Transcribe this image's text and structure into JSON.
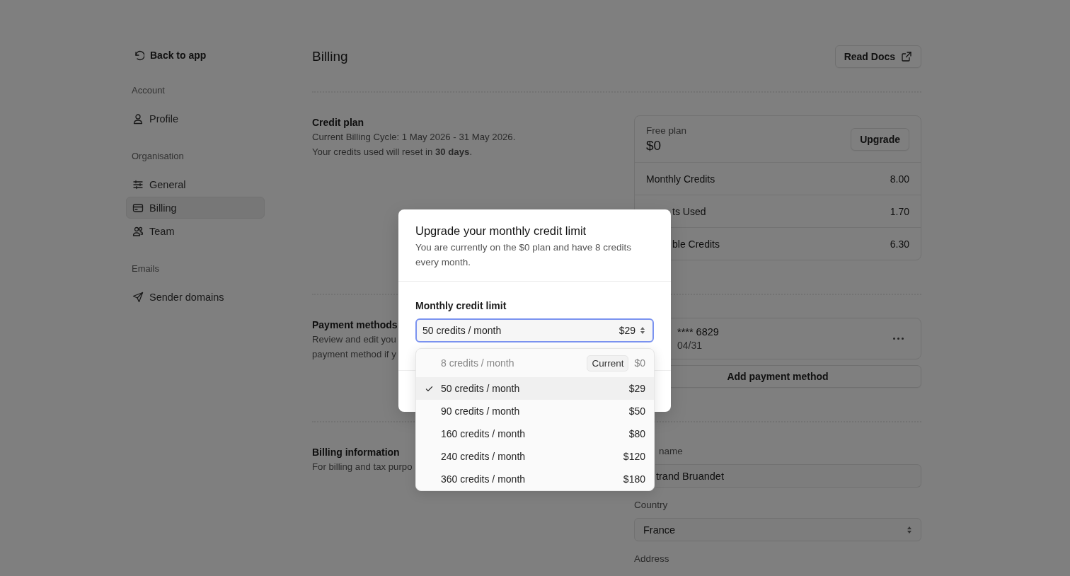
{
  "sidebar": {
    "back_link": "Back to app",
    "groups": [
      {
        "heading": "Account",
        "items": [
          {
            "label": "Profile",
            "kind": "user",
            "selected": false
          }
        ]
      },
      {
        "heading": "Organisation",
        "items": [
          {
            "label": "General",
            "kind": "sliders",
            "selected": false
          },
          {
            "label": "Billing",
            "kind": "card",
            "selected": true
          },
          {
            "label": "Team",
            "kind": "users",
            "selected": false
          }
        ]
      },
      {
        "heading": "Emails",
        "items": [
          {
            "label": "Sender domains",
            "kind": "send",
            "selected": false
          }
        ]
      }
    ]
  },
  "page": {
    "title": "Billing",
    "read_docs": "Read Docs"
  },
  "credit_plan": {
    "title": "Credit plan",
    "lines": [
      "Current Billing Cycle: 1 May 2026 - 31 May 2026.",
      "Your credits used will reset in **30 days**."
    ]
  },
  "plan_card": {
    "name": "Free plan",
    "price": "$0",
    "upgrade": "Upgrade",
    "rows": [
      {
        "label": "Monthly Credits",
        "value": "8.00"
      },
      {
        "label": "ts Used",
        "value": "1.70"
      },
      {
        "label": "ble Credits",
        "value": "6.30"
      }
    ]
  },
  "payment_methods": {
    "title": "Payment methods",
    "lines": [
      "Review and edit you",
      "payment method if y"
    ],
    "card": {
      "number": "**** 6829",
      "expiry": "04/31"
    },
    "add_button": "Add payment method"
  },
  "billing_information": {
    "title": "Billing information",
    "description": "For billing and tax purpo",
    "fields": [
      {
        "label": "name",
        "value": "trand Bruandet",
        "kind": "text"
      },
      {
        "label": "Country",
        "value": "France",
        "kind": "select"
      },
      {
        "label": "Address",
        "kind": "label"
      }
    ]
  },
  "modal": {
    "title": "Upgrade your monthly credit limit",
    "description": "You are currently on the $0 plan and have 8 credits every month.",
    "field_label": "Monthly credit limit",
    "select": {
      "value": "50 credits / month",
      "price": "$29"
    },
    "options": [
      {
        "label": "8 credits / month",
        "price": "$0",
        "badge": "Current",
        "disabled": true,
        "selected": false
      },
      {
        "label": "50 credits / month",
        "price": "$29",
        "disabled": false,
        "selected": true
      },
      {
        "label": "90 credits / month",
        "price": "$50",
        "disabled": false,
        "selected": false
      },
      {
        "label": "160 credits / month",
        "price": "$80",
        "disabled": false,
        "selected": false
      },
      {
        "label": "240 credits / month",
        "price": "$120",
        "disabled": false,
        "selected": false
      },
      {
        "label": "360 credits / month",
        "price": "$180",
        "disabled": false,
        "selected": false
      }
    ]
  }
}
